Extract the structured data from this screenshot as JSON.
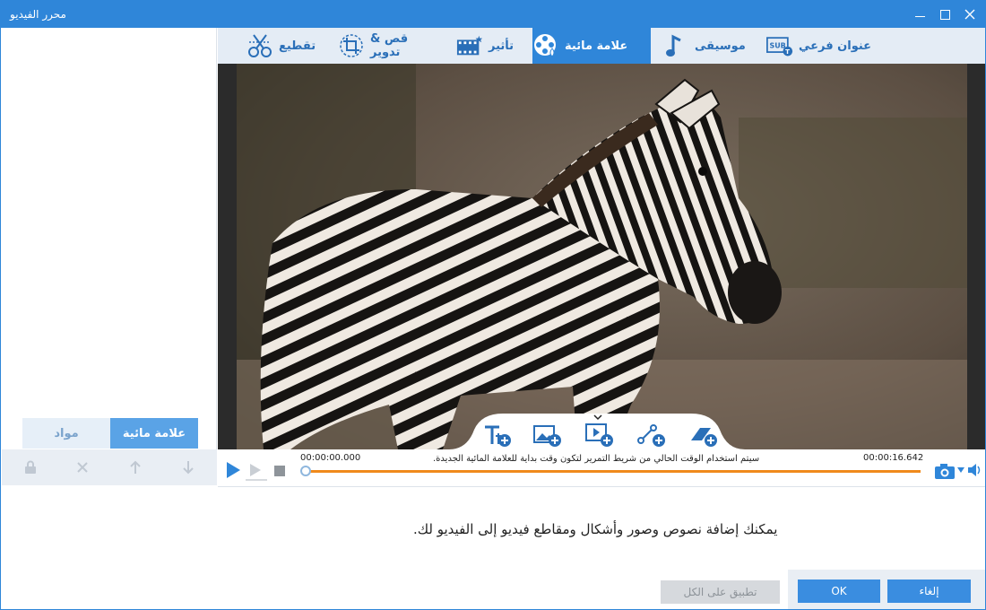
{
  "window": {
    "title": "محرر الفيديو"
  },
  "tabs": [
    {
      "label": "عنوان فرعي",
      "icon": "subtitle-icon",
      "active": false
    },
    {
      "label": "موسيقى",
      "icon": "music-note-icon",
      "active": false
    },
    {
      "label": "علامة مائية",
      "icon": "watermark-reel-icon",
      "active": true
    },
    {
      "label": "تأثير",
      "icon": "effect-film-icon",
      "active": false
    },
    {
      "label": "قص & تدوير",
      "icon": "crop-rotate-icon",
      "active": false
    },
    {
      "label": "تقطيع",
      "icon": "scissors-icon",
      "active": false
    }
  ],
  "left_panel": {
    "tabs": [
      {
        "label": "مواد",
        "active": false
      },
      {
        "label": "علامة مائية",
        "active": true
      }
    ],
    "toolbar_icons": [
      "lock-icon",
      "delete-x-icon",
      "move-up-icon",
      "move-down-icon"
    ]
  },
  "overlay_tools": [
    "add-text-icon",
    "add-image-icon",
    "add-video-icon",
    "add-shape-icon",
    "add-erase-icon"
  ],
  "playback": {
    "current_time": "00:00:00.000",
    "total_time": "00:00:16.642",
    "hint": "سيتم استخدام الوقت الحالي من شريط التمرير لتكون وقت بداية للعلامة المائية الجديدة."
  },
  "info_text": "يمكنك إضافة نصوص وصور وأشكال ومقاطع فيديو إلى الفيديو لك.",
  "buttons": {
    "apply_all": "تطبيق على الكل",
    "ok": "OK",
    "cancel": "إلغاء"
  },
  "colors": {
    "accent": "#2f86d9",
    "progress": "#f08a1c",
    "button_primary": "#3a8de0"
  }
}
